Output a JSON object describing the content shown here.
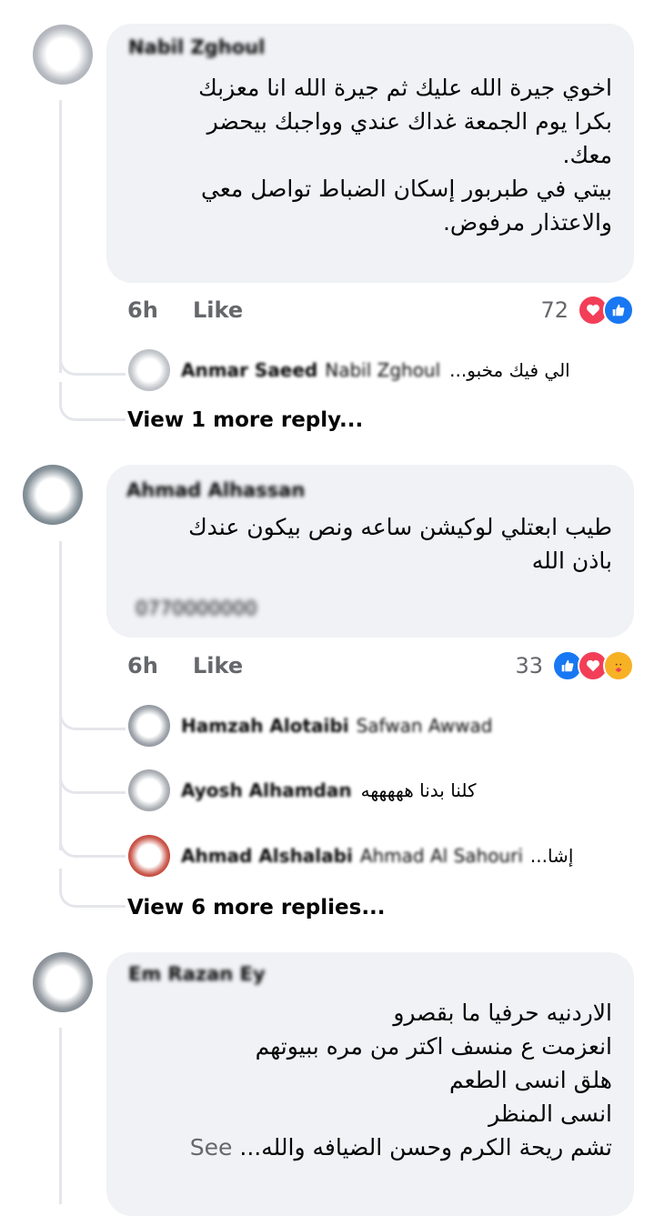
{
  "comments": [
    {
      "author": "Nabil Zghoul",
      "text_lines": [
        "اخوي جيرة الله عليك ثم جيرة الله انا معزبك",
        "بكرا يوم الجمعة غداك عندي وواجبك بيحضر",
        "معك.",
        "بيتي في طبربور إسكان الضباط تواصل معي",
        "والاعتذار مرفوض."
      ],
      "time": "6h",
      "like_label": "Like",
      "reaction_count": "72",
      "reactions": [
        "love",
        "like"
      ],
      "replies": [
        {
          "name": "Anmar Saeed",
          "mention": "Nabil Zghoul",
          "snippet": "الي فيك مخبو..."
        }
      ],
      "view_more": "View 1 more reply..."
    },
    {
      "author": "Ahmad Alhassan",
      "text_lines": [
        "طيب ابعتلي لوكيشن ساعه ونص بيكون عندك",
        "باذن الله"
      ],
      "hidden_line": "0770000000",
      "time": "6h",
      "like_label": "Like",
      "reaction_count": "33",
      "reactions": [
        "like",
        "love",
        "care"
      ],
      "replies": [
        {
          "name": "Hamzah Alotaibi",
          "mention": "Safwan Awwad",
          "snippet": ""
        },
        {
          "name": "Ayosh Alhamdan",
          "mention": "",
          "snippet": "كلنا بدنا هههههه"
        },
        {
          "name": "Ahmad Alshalabi",
          "mention": "Ahmad Al Sahouri",
          "snippet": "إشا..."
        }
      ],
      "view_more": "View 6 more replies..."
    },
    {
      "author": "Em Razan Ey",
      "text_lines": [
        "الاردنيه حرفيا ما بقصرو",
        "انعزمت ع منسف اكتر من مره ببيوتهم",
        "هلق انسى الطعم",
        "انسى المنظر",
        "تشم ريحة الكرم وحسن الضيافه والله..."
      ],
      "see_more": "See"
    }
  ],
  "colors": {
    "bubble": "#f0f2f5",
    "meta": "#65676b",
    "like_blue": "#1877f2",
    "love_red": "#f33e58",
    "care_yellow": "#f7b125"
  }
}
